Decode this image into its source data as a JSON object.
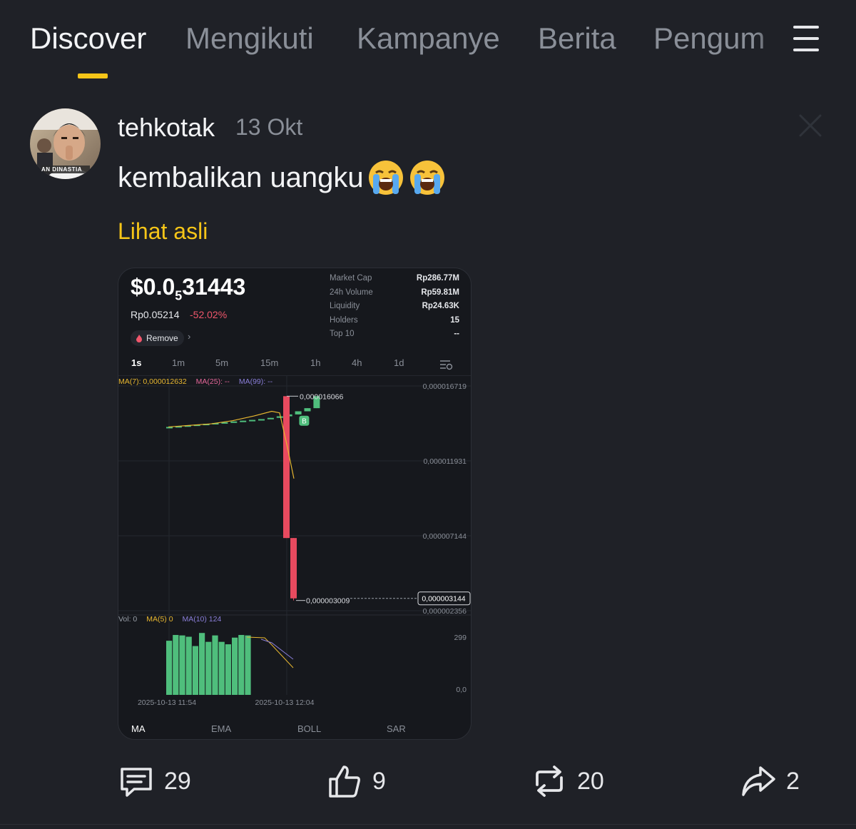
{
  "nav": {
    "tabs": [
      {
        "label": "Discover",
        "active": true
      },
      {
        "label": "Mengikuti"
      },
      {
        "label": "Kampanye"
      },
      {
        "label": "Berita"
      },
      {
        "label": "Pengum"
      }
    ],
    "menu_icon": "hamburger-menu-icon"
  },
  "post": {
    "username": "tehkotak",
    "date": "13 Okt",
    "text": "kembalikan uangku",
    "emojis": [
      "loudly-crying-face",
      "loudly-crying-face"
    ],
    "view_original": "Lihat asli",
    "avatar_caption": "AN DINASTIA"
  },
  "card": {
    "price_prefix": "$0.0",
    "price_sub": "5",
    "price_suffix": "31443",
    "idr_price": "Rp0.05214",
    "change": "-52.02%",
    "remove_label": "Remove",
    "stats": [
      {
        "label": "Market Cap",
        "value": "Rp286.77M"
      },
      {
        "label": "24h Volume",
        "value": "Rp59.81M"
      },
      {
        "label": "Liquidity",
        "value": "Rp24.63K"
      },
      {
        "label": "Holders",
        "value": "15"
      },
      {
        "label": "Top 10",
        "value": "--"
      }
    ],
    "intervals": [
      "1s",
      "1m",
      "5m",
      "15m",
      "1h",
      "4h",
      "1d"
    ],
    "active_interval": "1s",
    "indicators": [
      "MA",
      "EMA",
      "BOLL",
      "SAR"
    ],
    "active_indicator": "MA"
  },
  "chart_data": {
    "type": "candlestick",
    "ma_legend": {
      "ma7": "MA(7): 0,000012632",
      "ma25": "MA(25): --",
      "ma99": "MA(99): --"
    },
    "vol_legend": {
      "vol": "Vol: 0",
      "ma5": "MA(5) 0",
      "ma10": "MA(10) 124"
    },
    "y_ticks": [
      "0,000016719",
      "0,000011931",
      "0,000007144",
      "0,000002356"
    ],
    "current_price_label": "0,000003144",
    "high_label": "0,000016066",
    "low_label": "0,000003009",
    "buy_marker": "B",
    "vol_ticks": [
      "299",
      "0,0"
    ],
    "x_ticks": [
      "2025-10-13 11:54",
      "2025-10-13 12:04"
    ],
    "ylim": [
      2.356e-06,
      1.6719e-05
    ],
    "candles": [
      {
        "o": 1.41e-05,
        "c": 1.41e-05,
        "h": 1.41e-05,
        "l": 1.41e-05
      },
      {
        "o": 1.41e-05,
        "c": 1.415e-05,
        "h": 1.415e-05,
        "l": 1.41e-05
      },
      {
        "o": 1.415e-05,
        "c": 1.42e-05,
        "h": 1.42e-05,
        "l": 1.415e-05
      },
      {
        "o": 1.42e-05,
        "c": 1.425e-05,
        "h": 1.425e-05,
        "l": 1.42e-05
      },
      {
        "o": 1.425e-05,
        "c": 1.43e-05,
        "h": 1.43e-05,
        "l": 1.425e-05
      },
      {
        "o": 1.43e-05,
        "c": 1.435e-05,
        "h": 1.435e-05,
        "l": 1.43e-05
      },
      {
        "o": 1.435e-05,
        "c": 1.44e-05,
        "h": 1.44e-05,
        "l": 1.435e-05
      },
      {
        "o": 1.44e-05,
        "c": 1.445e-05,
        "h": 1.445e-05,
        "l": 1.44e-05
      },
      {
        "o": 1.445e-05,
        "c": 1.45e-05,
        "h": 1.45e-05,
        "l": 1.445e-05
      },
      {
        "o": 1.45e-05,
        "c": 1.455e-05,
        "h": 1.455e-05,
        "l": 1.45e-05
      },
      {
        "o": 1.455e-05,
        "c": 1.46e-05,
        "h": 1.46e-05,
        "l": 1.455e-05
      },
      {
        "o": 1.46e-05,
        "c": 1.468e-05,
        "h": 1.468e-05,
        "l": 1.46e-05
      },
      {
        "o": 1.468e-05,
        "c": 1.478e-05,
        "h": 1.478e-05,
        "l": 1.468e-05
      },
      {
        "o": 1.478e-05,
        "c": 1.49e-05,
        "h": 1.49e-05,
        "l": 1.478e-05
      },
      {
        "o": 1.49e-05,
        "c": 1.51e-05,
        "h": 1.51e-05,
        "l": 1.49e-05
      },
      {
        "o": 1.51e-05,
        "c": 1.53e-05,
        "h": 1.53e-05,
        "l": 1.51e-05
      },
      {
        "o": 1.53e-05,
        "c": 1.6066e-05,
        "h": 1.6066e-05,
        "l": 1.53e-05
      },
      {
        "o": 1.6066e-05,
        "c": 7e-06,
        "h": 1.6066e-05,
        "l": 7e-06
      },
      {
        "o": 7e-06,
        "c": 3.144e-06,
        "h": 7e-06,
        "l": 3.009e-06
      }
    ],
    "volumes": [
      0,
      0,
      0,
      0,
      0,
      0,
      0,
      0,
      0,
      244,
      270,
      268,
      262,
      220,
      279,
      239,
      268,
      239,
      228,
      258,
      270,
      268,
      0,
      0,
      0,
      0,
      0,
      0
    ],
    "ma7_line": [
      1.41e-05,
      1.42e-05,
      1.43e-05,
      1.45e-05,
      1.48e-05,
      1.51e-05,
      1.5e-05,
      1.3e-05,
      1.08e-05
    ],
    "vol_max": 299
  },
  "actions": {
    "comments": {
      "icon": "comment-icon",
      "count": "29"
    },
    "likes": {
      "icon": "thumbs-up-icon",
      "count": "9"
    },
    "reposts": {
      "icon": "repost-icon",
      "count": "20"
    },
    "shares": {
      "icon": "share-icon",
      "count": "2"
    }
  },
  "colors": {
    "background": "#1f2127",
    "accent": "#f5c518",
    "up": "#4fbe7c",
    "down": "#e84a5f",
    "ma7": "#e8b730",
    "ma25": "#e5679a",
    "ma99": "#8a7ed8"
  }
}
